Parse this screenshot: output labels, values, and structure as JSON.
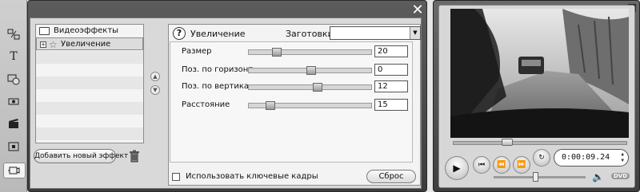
{
  "editor": {
    "close_icon": "close-icon",
    "tree": {
      "category": "Видеоэффекты",
      "selected_effect": "Увеличение"
    },
    "add_effect_label": "Добавить новый эффект",
    "help_icon": "?",
    "effect_title": "Увеличение",
    "presets_label": "Заготовки:",
    "presets_value": "",
    "params": [
      {
        "label": "Размер",
        "value": "20",
        "level": 0.2
      },
      {
        "label": "Поз. по горизонт.",
        "value": "0",
        "level": 0.5
      },
      {
        "label": "Поз. по вертика...",
        "value": "12",
        "level": 0.56
      },
      {
        "label": "Расстояние",
        "value": "15",
        "level": 0.15
      }
    ],
    "keyframes_label": "Использовать ключевые кадры",
    "reset_label": "Сброс"
  },
  "player": {
    "timecode": "0:00:09.24",
    "position": 0.3,
    "volume": 0.45,
    "dvd_label": "DVD"
  },
  "sidebar_icons": [
    "transitions-icon",
    "title-icon",
    "effects-icon",
    "audio-icon",
    "clapper-icon",
    "menu-icon",
    "video-effects-icon"
  ]
}
